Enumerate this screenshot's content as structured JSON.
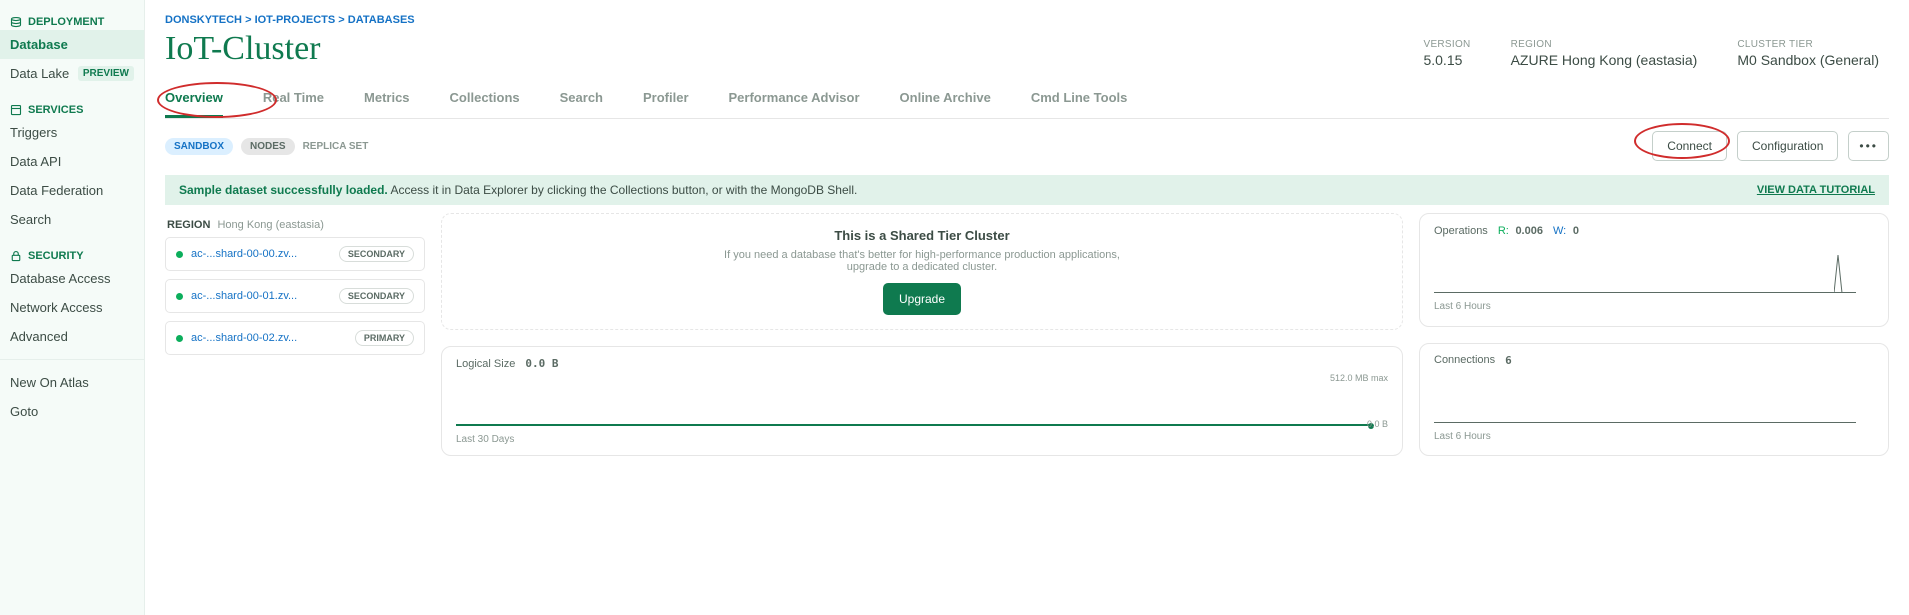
{
  "sidebar": {
    "sections": [
      {
        "icon": "deployment",
        "title": "DEPLOYMENT",
        "items": [
          {
            "label": "Database",
            "active": true
          },
          {
            "label": "Data Lake",
            "badge": "PREVIEW"
          }
        ]
      },
      {
        "icon": "services",
        "title": "SERVICES",
        "items": [
          {
            "label": "Triggers"
          },
          {
            "label": "Data API"
          },
          {
            "label": "Data Federation"
          },
          {
            "label": "Search"
          }
        ]
      },
      {
        "icon": "security",
        "title": "SECURITY",
        "items": [
          {
            "label": "Database Access"
          },
          {
            "label": "Network Access"
          },
          {
            "label": "Advanced"
          }
        ]
      }
    ],
    "footer": [
      {
        "label": "New On Atlas"
      },
      {
        "label": "Goto"
      }
    ]
  },
  "breadcrumbs": [
    {
      "label": "DONSKYTECH"
    },
    {
      "label": "IOT-PROJECTS"
    },
    {
      "label": "DATABASES"
    }
  ],
  "cluster_title": "IoT-Cluster",
  "meta": {
    "version": {
      "label": "VERSION",
      "value": "5.0.15"
    },
    "region": {
      "label": "REGION",
      "value": "AZURE Hong Kong (eastasia)"
    },
    "tier": {
      "label": "CLUSTER TIER",
      "value": "M0 Sandbox (General)"
    }
  },
  "tabs": [
    {
      "label": "Overview",
      "active": true
    },
    {
      "label": "Real Time"
    },
    {
      "label": "Metrics"
    },
    {
      "label": "Collections"
    },
    {
      "label": "Search"
    },
    {
      "label": "Profiler"
    },
    {
      "label": "Performance Advisor"
    },
    {
      "label": "Online Archive"
    },
    {
      "label": "Cmd Line Tools"
    }
  ],
  "pills": {
    "sandbox": "SANDBOX",
    "nodes": "NODES",
    "replica": "REPLICA SET"
  },
  "actions": {
    "connect": "Connect",
    "config": "Configuration",
    "more": "•••"
  },
  "banner": {
    "strong": "Sample dataset successfully loaded.",
    "rest": " Access it in Data Explorer by clicking the Collections button, or with the MongoDB Shell.",
    "link": "VIEW DATA TUTORIAL"
  },
  "region_panel": {
    "label": "REGION",
    "value": "Hong Kong (eastasia)",
    "nodes": [
      {
        "name": "ac-...shard-00-00.zv...",
        "role": "SECONDARY"
      },
      {
        "name": "ac-...shard-00-01.zv...",
        "role": "SECONDARY"
      },
      {
        "name": "ac-...shard-00-02.zv...",
        "role": "PRIMARY"
      }
    ]
  },
  "shared_tier": {
    "title": "This is a Shared Tier Cluster",
    "sub": "If you need a database that's better for high-performance production applications, upgrade to a dedicated cluster.",
    "button": "Upgrade"
  },
  "logical_size": {
    "title": "Logical Size",
    "value": "0.0 B",
    "max": "512.0 MB max",
    "min": "0.0 B",
    "footer": "Last 30 Days"
  },
  "operations": {
    "title": "Operations",
    "r_label": "R:",
    "r_value": "0.006",
    "w_label": "W:",
    "w_value": "0",
    "footer": "Last 6 Hours"
  },
  "connections": {
    "title": "Connections",
    "value": "6",
    "footer": "Last 6 Hours"
  },
  "chart_data": [
    {
      "type": "line",
      "title": "Operations",
      "series": [
        {
          "name": "R",
          "values_desc": "flat near 0 with single spike near end",
          "last": 0.006
        },
        {
          "name": "W",
          "values_desc": "flat at 0",
          "last": 0
        }
      ],
      "xlabel": "Last 6 Hours"
    },
    {
      "type": "line",
      "title": "Logical Size",
      "ylim": [
        0,
        536870912
      ],
      "ylabels": [
        "0.0 B",
        "512.0 MB max"
      ],
      "values_desc": "flat at 0.0 B",
      "xlabel": "Last 30 Days"
    },
    {
      "type": "line",
      "title": "Connections",
      "values_desc": "flat",
      "last": 6,
      "xlabel": "Last 6 Hours"
    }
  ]
}
